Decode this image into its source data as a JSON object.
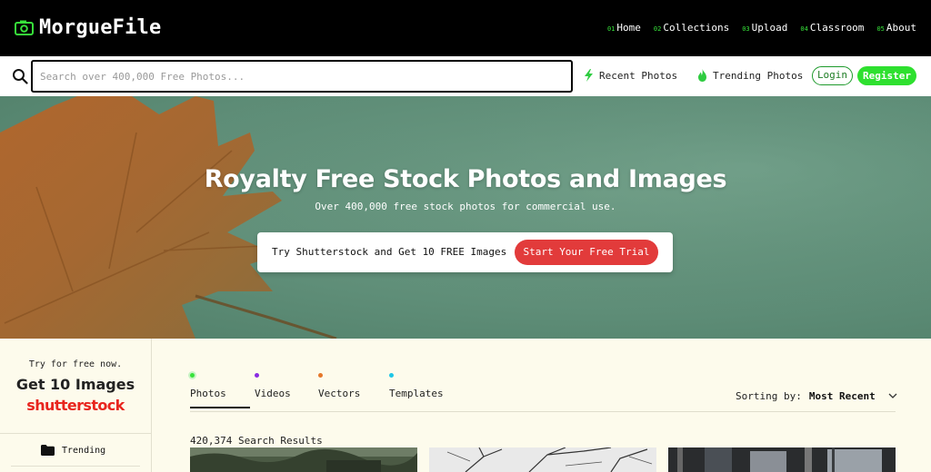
{
  "header": {
    "brand": "MorgueFile",
    "nav": [
      {
        "num": "01",
        "label": "Home"
      },
      {
        "num": "02",
        "label": "Collections"
      },
      {
        "num": "03",
        "label": "Upload"
      },
      {
        "num": "04",
        "label": "Classroom"
      },
      {
        "num": "05",
        "label": "About"
      }
    ]
  },
  "search": {
    "placeholder": "Search over 400,000 Free Photos...",
    "value": "",
    "recent_label": "Recent Photos",
    "trending_label": "Trending Photos",
    "login_label": "Login",
    "register_label": "Register"
  },
  "hero": {
    "title": "Royalty Free Stock Photos and Images",
    "subtitle": "Over 400,000 free stock photos for commercial use.",
    "promo_text": "Try Shutterstock and Get 10 FREE Images",
    "cta_label": "Start Your Free Trial"
  },
  "sidebar": {
    "ad_try": "Try for free now.",
    "ad_get": "Get 10 Images",
    "ad_brand": "shutterstock",
    "items": [
      {
        "label": "Trending",
        "icon": "folder-icon"
      }
    ]
  },
  "main": {
    "tabs": [
      {
        "label": "Photos",
        "dot_color": "#37e23a",
        "active": true
      },
      {
        "label": "Videos",
        "dot_color": "#8a2be2",
        "active": false
      },
      {
        "label": "Vectors",
        "dot_color": "#e5782a",
        "active": false
      },
      {
        "label": "Templates",
        "dot_color": "#1fc6e6",
        "active": false
      }
    ],
    "sort_label": "Sorting by:",
    "sort_value": "Most Recent",
    "results_text": "420,374 Search Results"
  },
  "colors": {
    "accent_green": "#2ee02f",
    "cta_red": "#e23b3b",
    "brand_red": "#e8251e",
    "page_bg": "#fdfbec"
  }
}
